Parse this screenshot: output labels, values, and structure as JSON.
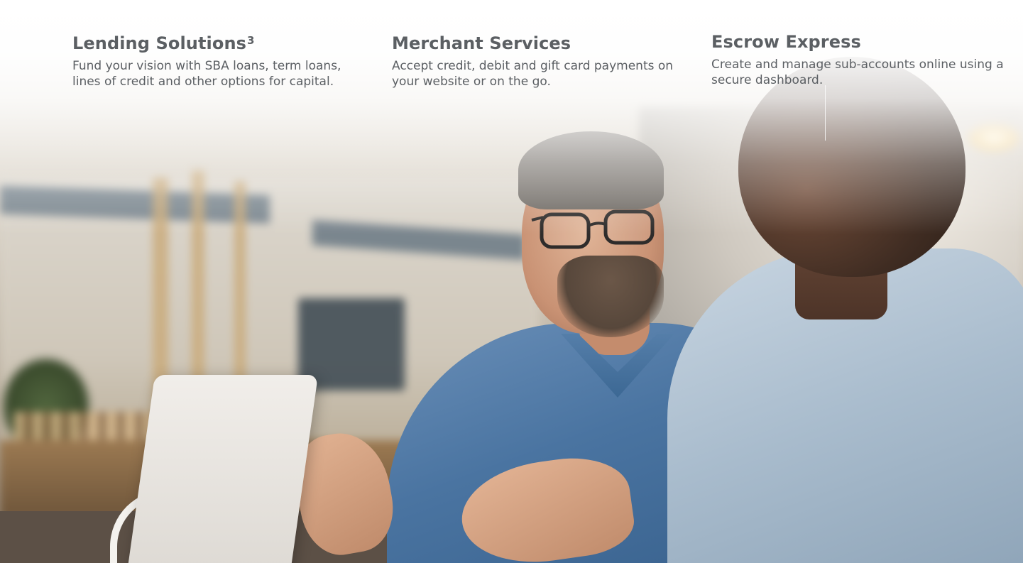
{
  "features": [
    {
      "title": "Lending Solutions",
      "superscript": "3",
      "description": "Fund your vision with SBA loans, term loans, lines of credit and other options for capital."
    },
    {
      "title": "Merchant Services",
      "description": "Accept credit, debit and gift card payments on your website or on the go."
    },
    {
      "title": "Escrow Express",
      "description": "Create and manage sub-accounts online using a secure dashboard."
    }
  ],
  "colors": {
    "text": "#5b5f63",
    "background": "#ffffff"
  }
}
